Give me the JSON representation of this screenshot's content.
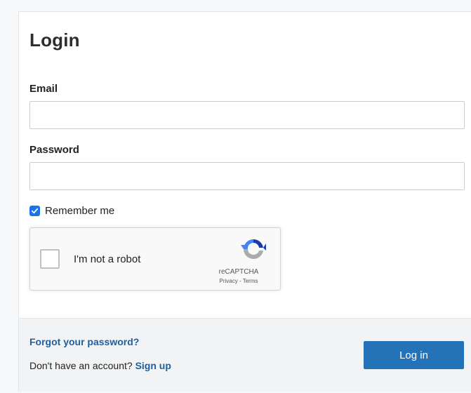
{
  "form": {
    "title": "Login",
    "email": {
      "label": "Email",
      "value": "",
      "placeholder": ""
    },
    "password": {
      "label": "Password",
      "value": "",
      "placeholder": ""
    },
    "remember_me": {
      "label": "Remember me",
      "checked": true
    }
  },
  "recaptcha": {
    "label": "I'm not a robot",
    "brand": "reCAPTCHA",
    "links": "Privacy - Terms",
    "icon": "recaptcha-logo-icon"
  },
  "footer": {
    "forgot_label": "Forgot your password?",
    "signup_prompt": "Don't have an account?",
    "signup_label": "Sign up",
    "login_button": "Log in"
  },
  "colors": {
    "accent": "#2473b8",
    "link": "#1d5fa0",
    "checkbox": "#1a73e8"
  }
}
